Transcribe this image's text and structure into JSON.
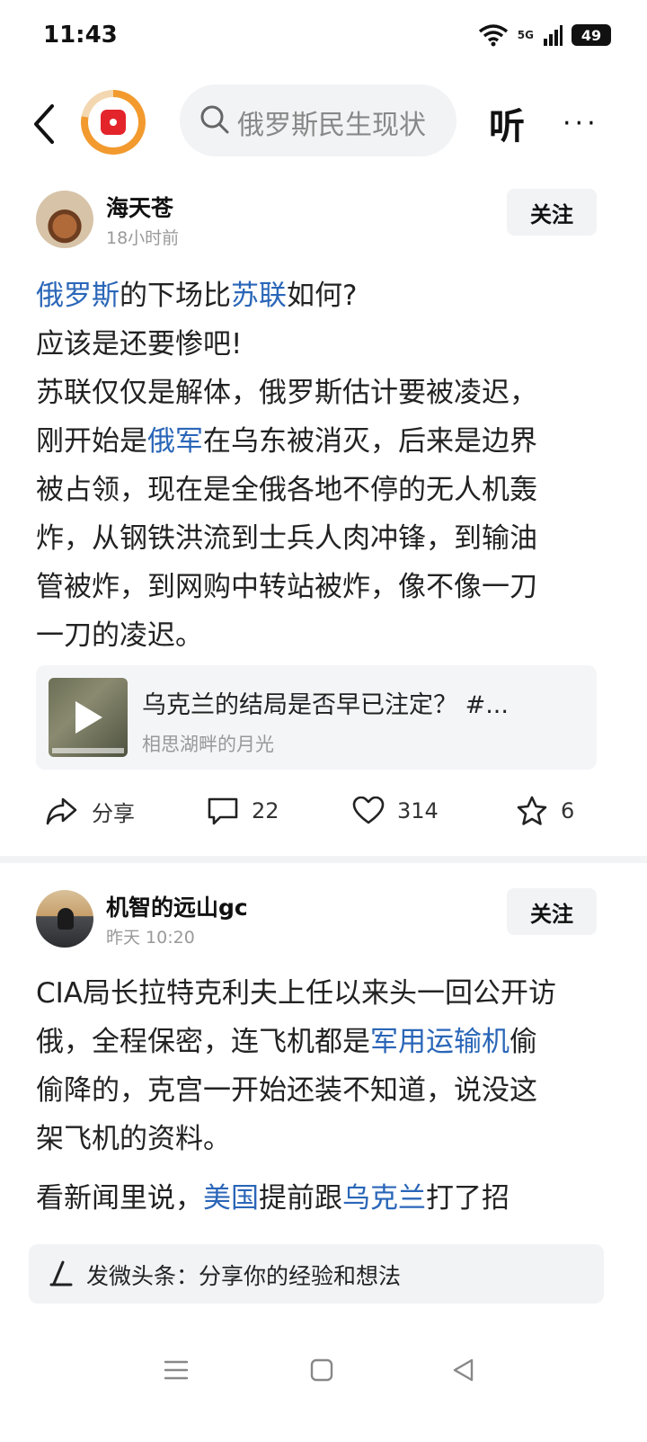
{
  "status": {
    "time": "11:43",
    "network": "5G",
    "battery": "49"
  },
  "topbar": {
    "search_placeholder": "俄罗斯民生现状",
    "listen_label": "听",
    "more_label": "···"
  },
  "posts": [
    {
      "author": "海天苍",
      "time": "18小时前",
      "follow_label": "关注",
      "lines": [
        [
          {
            "t": "俄罗斯",
            "link": true
          },
          {
            "t": "的下场比"
          },
          {
            "t": "苏联",
            "link": true
          },
          {
            "t": "如何?"
          }
        ],
        [
          {
            "t": "应该是还要惨吧!"
          }
        ],
        [
          {
            "t": "苏联仅仅是解体，俄罗斯估计要被凌迟，"
          }
        ],
        [
          {
            "t": "刚开始是"
          },
          {
            "t": "俄军",
            "link": true
          },
          {
            "t": "在乌东被消灭，后来是边界"
          }
        ],
        [
          {
            "t": "被占领，现在是全俄各地不停的无人机轰"
          }
        ],
        [
          {
            "t": "炸，从钢铁洪流到士兵人肉冲锋，到输油"
          }
        ],
        [
          {
            "t": "管被炸，到网购中转站被炸，像不像一刀"
          }
        ],
        [
          {
            "t": "一刀的凌迟。"
          }
        ]
      ],
      "card": {
        "title": "乌克兰的结局是否早已注定？ #...",
        "source": "相思湖畔的月光"
      },
      "actions": {
        "share": "分享",
        "comments": "22",
        "likes": "314",
        "favorites": "6"
      }
    },
    {
      "author": "机智的远山gc",
      "time": "昨天 10:20",
      "follow_label": "关注",
      "lines": [
        [
          {
            "t": "CIA局长拉特克利夫上任以来头一回公开访"
          }
        ],
        [
          {
            "t": "俄，全程保密，连飞机都是"
          },
          {
            "t": "军用运输机",
            "link": true
          },
          {
            "t": "偷"
          }
        ],
        [
          {
            "t": "偷降的，克宫一开始还装不知道，说没这"
          }
        ],
        [
          {
            "t": "架飞机的资料。"
          }
        ],
        [
          {
            "t": ""
          }
        ],
        [
          {
            "t": "看新闻里说，"
          },
          {
            "t": "美国",
            "link": true
          },
          {
            "t": "提前跟"
          },
          {
            "t": "乌克兰",
            "link": true
          },
          {
            "t": "打了招"
          }
        ]
      ]
    }
  ],
  "composer": {
    "placeholder": "发微头条：分享你的经验和想法"
  },
  "colors": {
    "link": "#2a66b8",
    "background": "#ffffff",
    "gray_bg": "#f2f3f5"
  },
  "icons": [
    "back-icon",
    "app-logo-icon",
    "search-icon",
    "share-icon",
    "comment-icon",
    "like-icon",
    "favorite-icon",
    "pen-icon",
    "menu-icon",
    "home-icon",
    "back-nav-icon"
  ]
}
